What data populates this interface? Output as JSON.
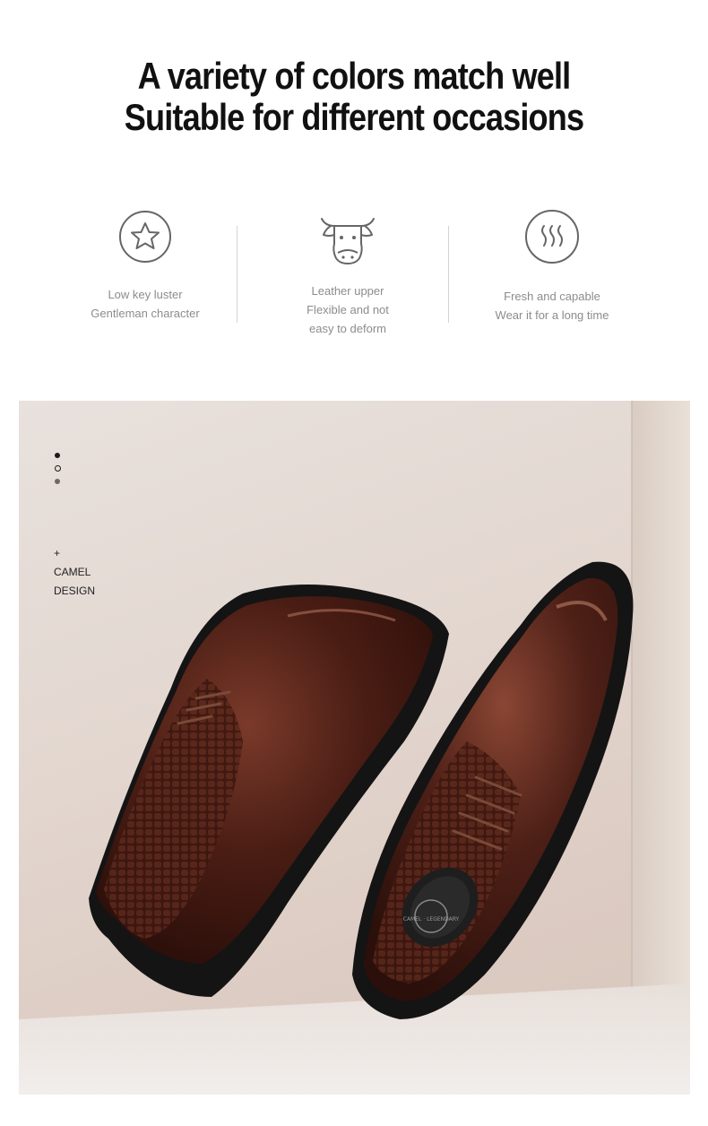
{
  "headline": {
    "line1": "A variety of colors match well",
    "line2": "Suitable for different occasions"
  },
  "features": [
    {
      "icon": "star-icon",
      "line1": "Low key luster",
      "line2": "Gentleman character"
    },
    {
      "icon": "cow-icon",
      "line1": "Leather upper",
      "line2": "Flexible and not",
      "line3": "easy to deform"
    },
    {
      "icon": "heat-waves-icon",
      "line1": "Fresh and capable",
      "line2": "Wear it for a long time"
    }
  ],
  "photo": {
    "plus": "+",
    "brand_line1": "CAMEL",
    "brand_line2": "DESIGN",
    "insole_logo_text": "CAMEL · LEGENDARY"
  },
  "colors": {
    "headline": "#111111",
    "feature_text": "#8c8c8c",
    "icon_stroke": "#666666",
    "leather": "#4a1d14",
    "sole": "#141414"
  }
}
